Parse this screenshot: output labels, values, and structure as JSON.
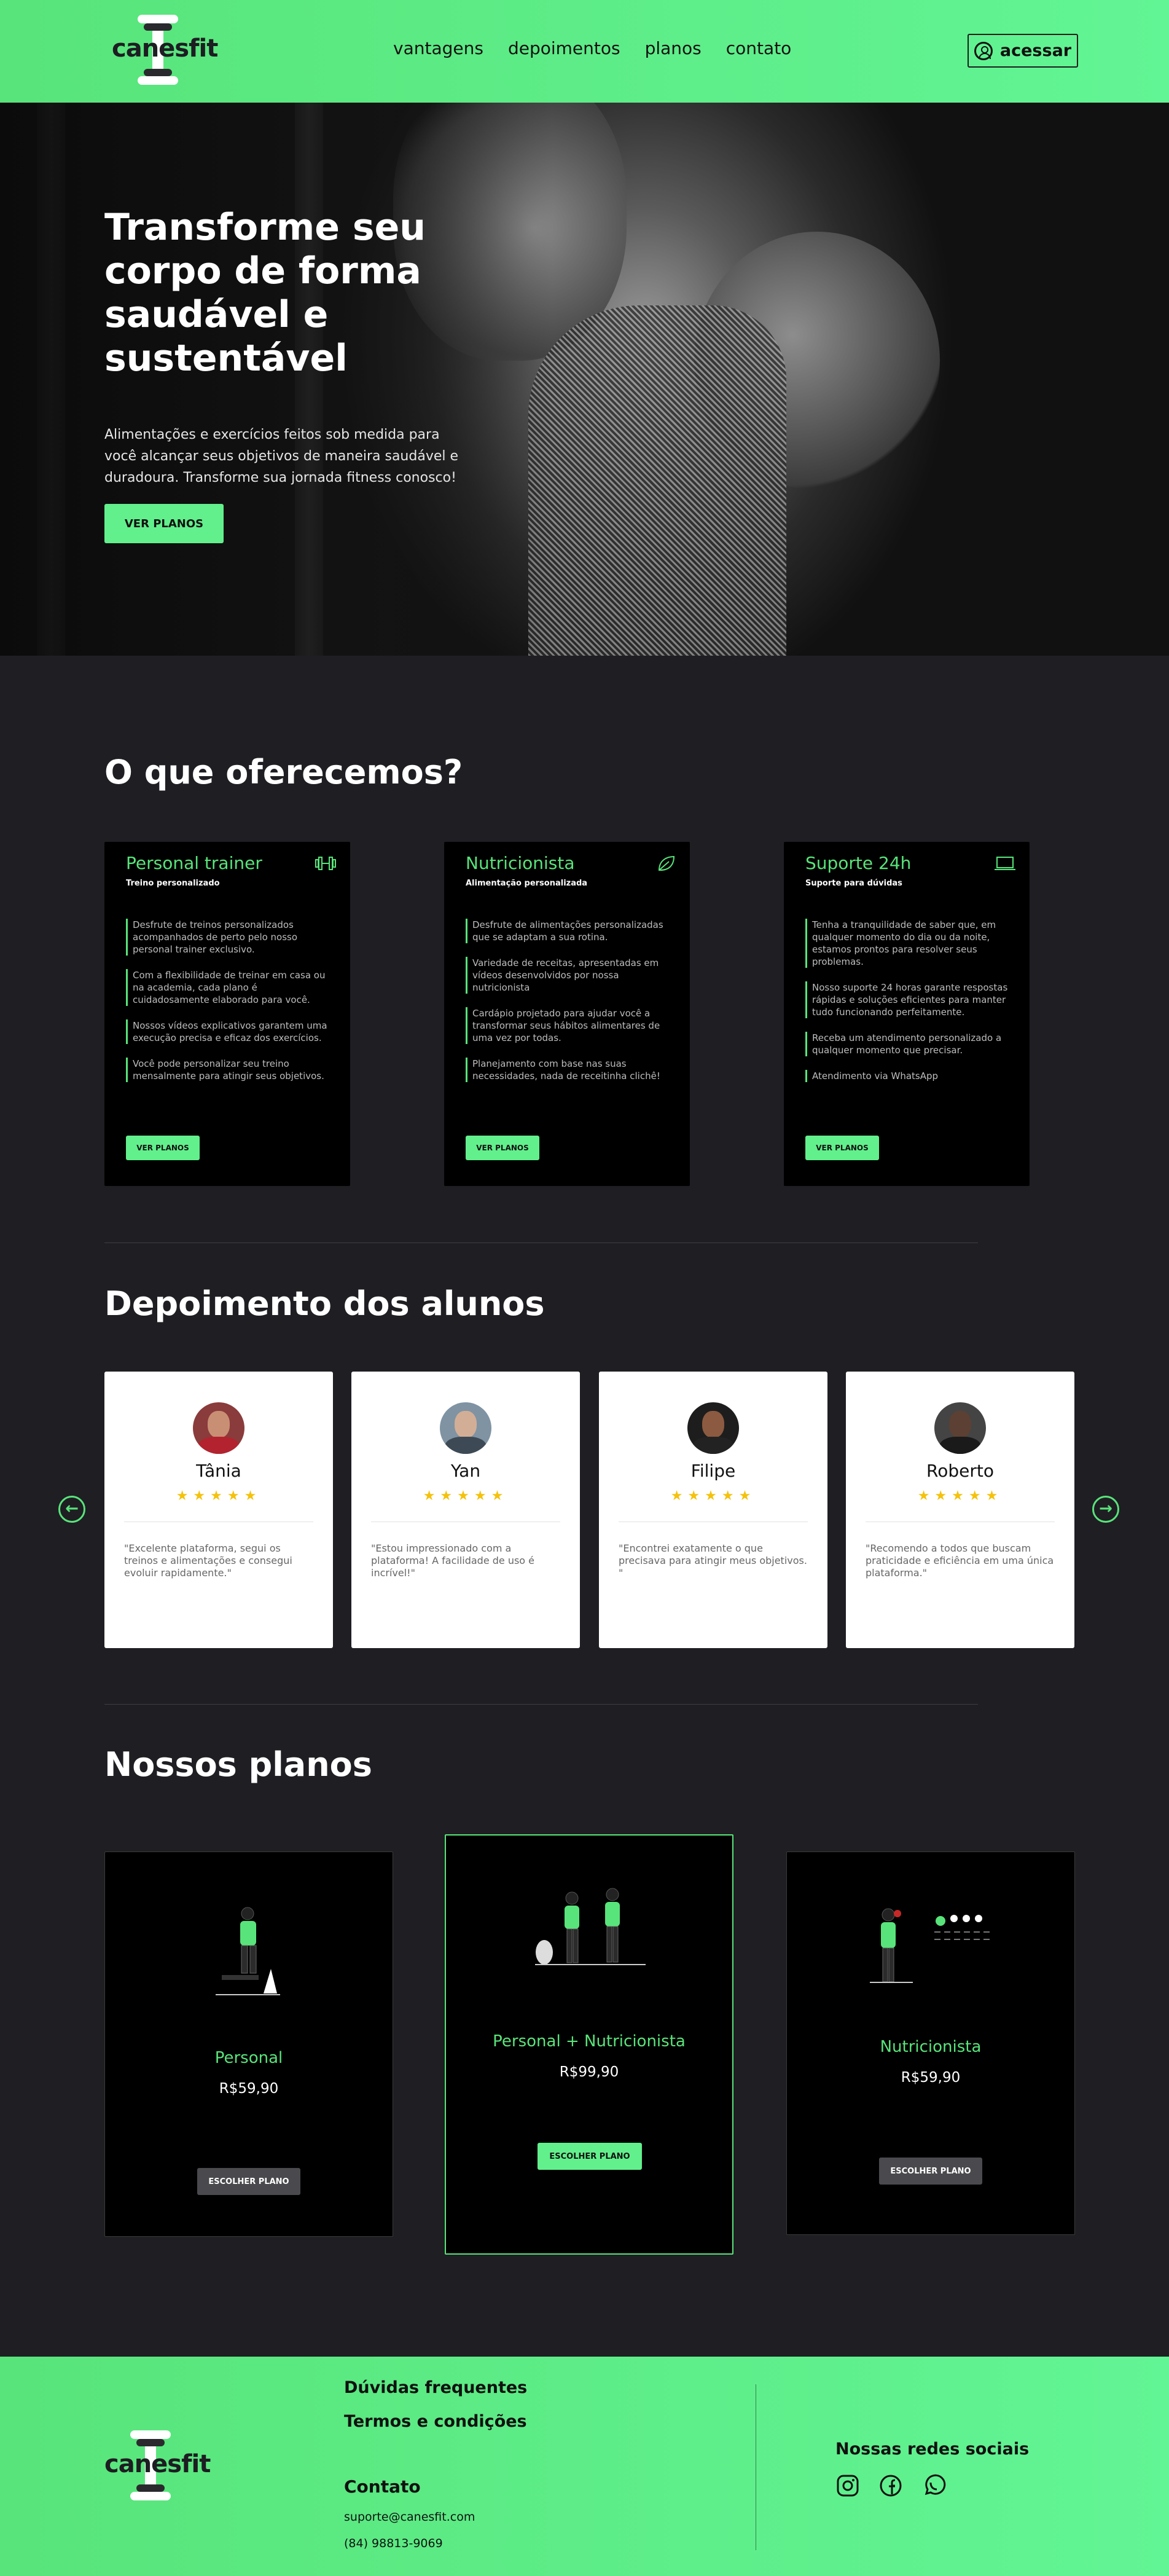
{
  "header": {
    "logo_text": "canesfit",
    "nav": [
      "vantagens",
      "depoimentos",
      "planos",
      "contato"
    ],
    "access_label": "acessar"
  },
  "hero": {
    "title": "Transforme seu corpo de forma saudável e sustentável",
    "description": "Alimentações e exercícios feitos sob medida para você alcançar seus objetivos de maneira saudável e duradoura. Transforme sua jornada fitness conosco!",
    "button": "VER PLANOS"
  },
  "offers": {
    "title": "O que oferecemos?",
    "cards": [
      {
        "title": "Personal trainer",
        "subtitle": "Treino personalizado",
        "icon": "dumbbell-icon",
        "items": [
          "Desfrute de treinos personalizados acompanhados de perto pelo nosso personal trainer exclusivo.",
          "Com a flexibilidade de treinar em casa ou na academia, cada plano é cuidadosamente elaborado para você.",
          "Nossos vídeos explicativos garantem uma execução precisa e eficaz dos exercícios.",
          "Você pode personalizar seu treino mensalmente para atingir seus objetivos."
        ],
        "button": "VER PLANOS"
      },
      {
        "title": "Nutricionista",
        "subtitle": "Alimentação personalizada",
        "icon": "leaf-icon",
        "items": [
          "Desfrute de alimentações personalizadas que se adaptam a sua rotina.",
          "Variedade de receitas, apresentadas em vídeos desenvolvidos por nossa nutricionista",
          "Cardápio projetado para ajudar você a transformar seus hábitos alimentares de uma vez por todas.",
          "Planejamento com base nas suas necessidades, nada de receitinha clichê!"
        ],
        "button": "VER PLANOS"
      },
      {
        "title": "Suporte 24h",
        "subtitle": "Suporte para dúvidas",
        "icon": "laptop-icon",
        "items": [
          "Tenha a tranquilidade de saber que, em qualquer momento do dia ou da noite, estamos prontos para resolver seus problemas.",
          "Nosso suporte 24 horas garante respostas rápidas e soluções eficientes para manter tudo funcionando perfeitamente.",
          "Receba um atendimento personalizado a qualquer momento que precisar.",
          "Atendimento via WhatsApp"
        ],
        "button": "VER PLANOS"
      }
    ]
  },
  "testimonials": {
    "title": "Depoimento dos alunos",
    "items": [
      {
        "name": "Tânia",
        "stars": "★★★★★",
        "quote": "\"Excelente plataforma, segui os treinos e alimentações e consegui evoluir rapidamente.\""
      },
      {
        "name": "Yan",
        "stars": "★★★★★",
        "quote": "\"Estou impressionado com a plataforma! A facilidade de uso é incrível!\""
      },
      {
        "name": "Filipe",
        "stars": "★★★★★",
        "quote": "\"Encontrei exatamente o que precisava para atingir meus objetivos. \""
      },
      {
        "name": "Roberto",
        "stars": "★★★★★",
        "quote": "\"Recomendo a todos que buscam praticidade e eficiência em uma única plataforma.\""
      }
    ]
  },
  "plans": {
    "title": "Nossos planos",
    "items": [
      {
        "name": "Personal",
        "price": "R$59,90",
        "button": "ESCOLHER PLANO"
      },
      {
        "name": "Personal + Nutricionista",
        "price": "R$99,90",
        "button": "ESCOLHER PLANO"
      },
      {
        "name": "Nutricionista",
        "price": "R$59,90",
        "button": "ESCOLHER PLANO"
      }
    ]
  },
  "footer": {
    "logo_text": "canesfit",
    "links": [
      "Dúvidas frequentes",
      "Termos e condições"
    ],
    "contact_title": "Contato",
    "email": "suporte@canesfit.com",
    "phone": "(84) 98813-9069",
    "social_title": "Nossas redes sociais",
    "social_icons": [
      "instagram-icon",
      "facebook-icon",
      "whatsapp-icon"
    ]
  },
  "colors": {
    "accent": "#58e47a",
    "background": "#1f1e23",
    "card": "#000000",
    "star": "#f4c20d"
  }
}
